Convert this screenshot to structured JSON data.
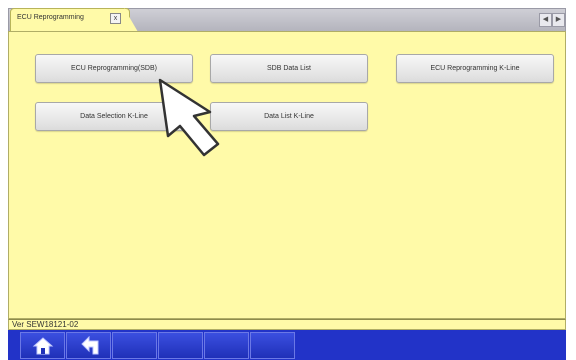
{
  "tab": {
    "title": "ECU Reprogramming",
    "close_symbol": "x"
  },
  "nav": {
    "prev_symbol": "◀",
    "next_symbol": "▶"
  },
  "functions": {
    "ecu_sdb": "ECU Reprogramming(SDB)",
    "sdb_data_list": "SDB Data List",
    "ecu_kline": "ECU Reprogramming K-Line",
    "data_selection_kline": "Data Selection K-Line",
    "data_list_kline": "Data List K-Line"
  },
  "version": "Ver SEW18121-02",
  "toolbar": {
    "home_icon": "home-icon",
    "back_icon": "return-icon",
    "accent": "#2233c8"
  },
  "colors": {
    "panel": "#fffaa8",
    "pointer": "#ffffff"
  }
}
